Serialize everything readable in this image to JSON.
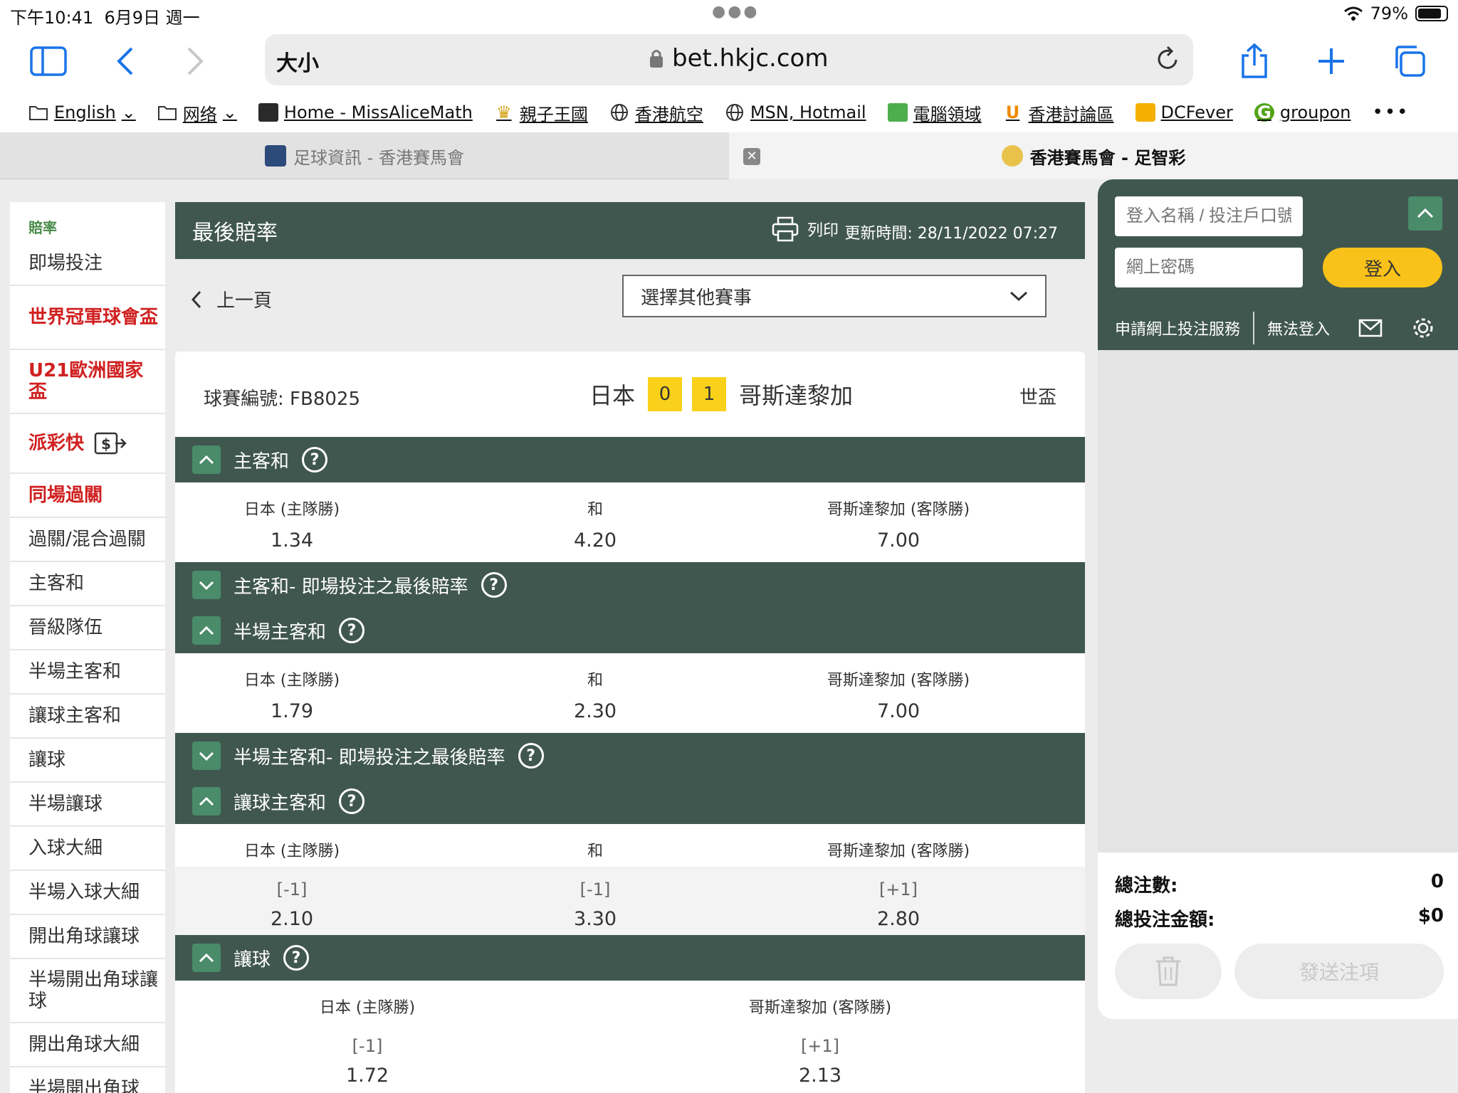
{
  "status": {
    "time": "下午10:41",
    "date": "6月9日 週一",
    "battery": "79%"
  },
  "browser": {
    "text_size": "大小",
    "url": "bet.hkjc.com"
  },
  "bookmarks": [
    {
      "label": "English",
      "icon": "folder-icon"
    },
    {
      "label": "网络",
      "icon": "folder-icon"
    },
    {
      "label": "Home - MissAliceMath",
      "icon": "site-icon"
    },
    {
      "label": "親子王國",
      "icon": "crown-icon"
    },
    {
      "label": "香港航空",
      "icon": "globe-icon"
    },
    {
      "label": "MSN, Hotmail",
      "icon": "globe-icon"
    },
    {
      "label": "電腦領域",
      "icon": "site-icon"
    },
    {
      "label": "香港討論區",
      "icon": "site-icon"
    },
    {
      "label": "DCFever",
      "icon": "site-icon"
    },
    {
      "label": "groupon",
      "icon": "site-icon"
    }
  ],
  "tabs": {
    "inactive": "足球資訊 - 香港賽馬會",
    "active": "香港賽馬會 - 足智彩"
  },
  "sidebar": {
    "heading": "賠率",
    "items": [
      {
        "label": "即場投注",
        "red": false
      },
      {
        "label": "世界冠軍球會盃",
        "red": true
      },
      {
        "label": "U21歐洲國家盃",
        "red": true
      },
      {
        "label": "派彩快",
        "red": true
      },
      {
        "label": "同場過關",
        "red": true
      },
      {
        "label": "過關/混合過關",
        "red": false
      },
      {
        "label": "主客和",
        "red": false
      },
      {
        "label": "晉級隊伍",
        "red": false
      },
      {
        "label": "半場主客和",
        "red": false
      },
      {
        "label": "讓球主客和",
        "red": false
      },
      {
        "label": "讓球",
        "red": false
      },
      {
        "label": "半場讓球",
        "red": false
      },
      {
        "label": "入球大細",
        "red": false
      },
      {
        "label": "半場入球大細",
        "red": false
      },
      {
        "label": "開出角球讓球",
        "red": false
      },
      {
        "label": "半場開出角球讓球",
        "red": false
      },
      {
        "label": "開出角球大細",
        "red": false
      },
      {
        "label": "半場開出角球",
        "red": false
      }
    ]
  },
  "main": {
    "title": "最後賠率",
    "print": "列印",
    "updated": "更新時間: 28/11/2022 07:27",
    "back": "上一頁",
    "select": "選擇其他賽事"
  },
  "match": {
    "id": "球賽編號: FB8025",
    "home": "日本",
    "home_score": "0",
    "away_score": "1",
    "away": "哥斯達黎加",
    "competition": "世盃"
  },
  "sections": {
    "hda": "主客和",
    "hda_inplay": "主客和- 即場投注之最後賠率",
    "fhda": "半場主客和",
    "fhda_inplay": "半場主客和- 即場投注之最後賠率",
    "hhda": "讓球主客和",
    "hdc": "讓球"
  },
  "labels": {
    "home": "日本 (主隊勝)",
    "draw": "和",
    "away": "哥斯達黎加 (客隊勝)"
  },
  "odds": {
    "hda": [
      "1.34",
      "4.20",
      "7.00"
    ],
    "fhda": [
      "1.79",
      "2.30",
      "7.00"
    ],
    "hhda_lines": [
      "[-1]",
      "[-1]",
      "[+1]"
    ],
    "hhda": [
      "2.10",
      "3.30",
      "2.80"
    ],
    "hdc_lines": [
      "[-1]",
      "[+1]"
    ],
    "hdc": [
      "1.72",
      "2.13"
    ]
  },
  "login": {
    "user_placeholder": "登入名稱 / 投注戶口號碼",
    "pass_placeholder": "網上密碼",
    "login_btn": "登入",
    "apply": "申請網上投注服務",
    "cannot_login": "無法登入"
  },
  "betslip": {
    "count_label": "總注數:",
    "count": "0",
    "amount_label": "總投注金額:",
    "amount": "$0",
    "send": "發送注項"
  }
}
